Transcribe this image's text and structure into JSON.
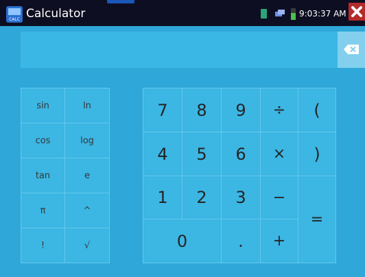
{
  "app": {
    "title": "Calculator",
    "icon_label": "CALC"
  },
  "status": {
    "time": "9:03:37 AM"
  },
  "display": {
    "value": ""
  },
  "scientific_keys": [
    "sin",
    "ln",
    "cos",
    "log",
    "tan",
    "e",
    "π",
    "^",
    "!",
    "√"
  ],
  "numeric_keys": {
    "seven": "7",
    "eight": "8",
    "nine": "9",
    "divide": "÷",
    "open_paren": "(",
    "four": "4",
    "five": "5",
    "six": "6",
    "multiply": "×",
    "close_paren": ")",
    "one": "1",
    "two": "2",
    "three": "3",
    "minus": "−",
    "zero": "0",
    "dot": ".",
    "plus": "+",
    "equals": "="
  },
  "colors": {
    "background": "#2fa7d8",
    "key": "#3cb6e3",
    "key_border": "#63c9ee",
    "topbar": "#0e0e22",
    "close": "#b52a2a"
  },
  "icons": {
    "app": "calculator-app-icon",
    "status": [
      "phone-icon",
      "sim-cards-icon",
      "battery-icon"
    ],
    "close": "close-icon",
    "backspace": "backspace-icon"
  }
}
